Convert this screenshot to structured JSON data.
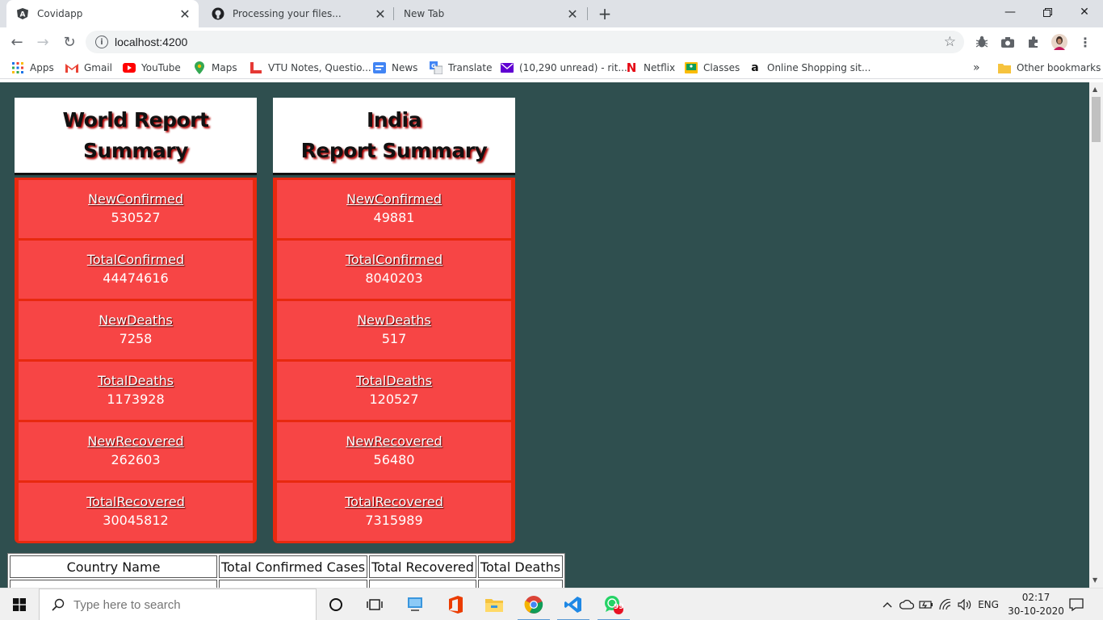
{
  "browser": {
    "tabs": [
      {
        "title": "Covidapp",
        "icon": "angular-icon",
        "active": true
      },
      {
        "title": "Processing your files...",
        "icon": "github-icon",
        "active": false
      },
      {
        "title": "New Tab",
        "icon": "",
        "active": false
      }
    ],
    "address": "localhost:4200",
    "bookmarks": [
      {
        "label": "Apps",
        "icon": "apps-grid-icon"
      },
      {
        "label": "Gmail",
        "icon": "gmail-icon"
      },
      {
        "label": "YouTube",
        "icon": "youtube-icon"
      },
      {
        "label": "Maps",
        "icon": "maps-icon"
      },
      {
        "label": "VTU Notes, Questio...",
        "icon": "vtu-icon"
      },
      {
        "label": "News",
        "icon": "news-icon"
      },
      {
        "label": "Translate",
        "icon": "translate-icon"
      },
      {
        "label": "(10,290 unread) - rit...",
        "icon": "yahoo-mail-icon"
      },
      {
        "label": "Netflix",
        "icon": "netflix-icon"
      },
      {
        "label": "Classes",
        "icon": "classroom-icon"
      },
      {
        "label": "Online Shopping sit...",
        "icon": "amazon-icon"
      }
    ],
    "overflow": "»",
    "other_bookmarks": "Other bookmarks"
  },
  "world": {
    "title": "World Report\nSummary",
    "stats": [
      {
        "label": "NewConfirmed",
        "value": "530527"
      },
      {
        "label": "TotalConfirmed",
        "value": "44474616"
      },
      {
        "label": "NewDeaths",
        "value": "7258"
      },
      {
        "label": "TotalDeaths",
        "value": "1173928"
      },
      {
        "label": "NewRecovered",
        "value": "262603"
      },
      {
        "label": "TotalRecovered",
        "value": "30045812"
      }
    ]
  },
  "india": {
    "title": "India\nReport Summary",
    "stats": [
      {
        "label": "NewConfirmed",
        "value": "49881"
      },
      {
        "label": "TotalConfirmed",
        "value": "8040203"
      },
      {
        "label": "NewDeaths",
        "value": "517"
      },
      {
        "label": "TotalDeaths",
        "value": "120527"
      },
      {
        "label": "NewRecovered",
        "value": "56480"
      },
      {
        "label": "TotalRecovered",
        "value": "7315989"
      }
    ]
  },
  "table": {
    "headers": [
      "Country Name",
      "Total Confirmed Cases",
      "Total Recovered",
      "Total Deaths"
    ]
  },
  "taskbar": {
    "search_placeholder": "Type here to search",
    "language": "ENG",
    "time": "02:17",
    "date": "30-10-2020",
    "whatsapp_badge": "99"
  },
  "colors": {
    "page_bg": "#2f4f4f",
    "stat_bg": "#f74545",
    "stat_border": "#e8290f"
  }
}
